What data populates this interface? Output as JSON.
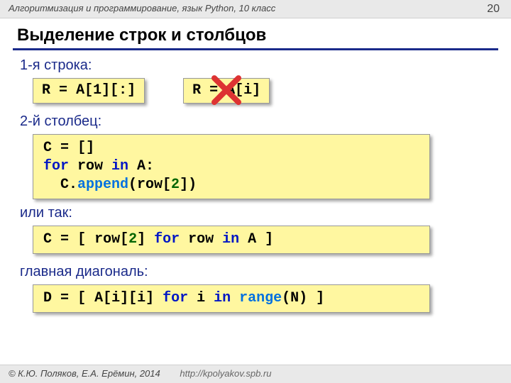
{
  "header": {
    "course": "Алгоритмизация и программирование, язык Python, 10 класс",
    "page": "20"
  },
  "title": "Выделение строк и столбцов",
  "labels": {
    "row1": "1-я строка:",
    "col2": "2-й столбец:",
    "or": "или так:",
    "diag": "главная диагональ:"
  },
  "code": {
    "slice_full_pre": "R",
    "slice_full_eq": "=",
    "slice_full_post": "A[1][:]",
    "slice_wrong_pre": "R",
    "slice_wrong_eq": "=",
    "slice_wrong_post": "A[i]",
    "col_c": "C",
    "col_eq": "=",
    "col_empty": "[]",
    "col_for": "for",
    "col_row": " row ",
    "col_in": "in",
    "col_a": " A:",
    "col_indent": "  C.",
    "col_append": "append",
    "col_open": "(row[",
    "col_two": "2",
    "col_close": "])",
    "lc_c": "C",
    "lc_eq": "=",
    "lc_open": "[ row[",
    "lc_two": "2",
    "lc_mid": "] ",
    "lc_for": "for",
    "lc_row": " row ",
    "lc_in": "in",
    "lc_a": " A ]",
    "d_d": "D",
    "d_eq": "=",
    "d_open": "[ A[i][i] ",
    "d_for": "for",
    "d_i": " i ",
    "d_in": "in",
    "d_sp": " ",
    "d_range": "range",
    "d_close": "(N) ]"
  },
  "footer": {
    "copyright": "© К.Ю. Поляков, Е.А. Ерёмин, 2014",
    "url": "http://kpolyakov.spb.ru"
  }
}
